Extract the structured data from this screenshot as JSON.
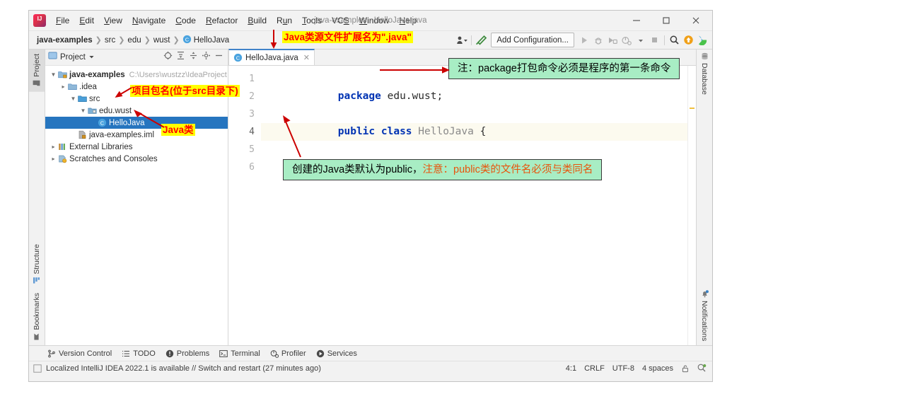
{
  "window": {
    "title": "java-examples - HelloJava.java",
    "logo_icon": "intellij-idea-logo",
    "minimize_label": "—",
    "maximize_label": "□",
    "close_label": "✕"
  },
  "menu": [
    {
      "label": "File",
      "mnemonic": "F"
    },
    {
      "label": "Edit",
      "mnemonic": "E"
    },
    {
      "label": "View",
      "mnemonic": "V"
    },
    {
      "label": "Navigate",
      "mnemonic": "N"
    },
    {
      "label": "Code",
      "mnemonic": "C"
    },
    {
      "label": "Refactor",
      "mnemonic": "R"
    },
    {
      "label": "Build",
      "mnemonic": "B"
    },
    {
      "label": "Run",
      "mnemonic": "u"
    },
    {
      "label": "Tools",
      "mnemonic": "T"
    },
    {
      "label": "VCS",
      "mnemonic": "S"
    },
    {
      "label": "Window",
      "mnemonic": "W"
    },
    {
      "label": "Help",
      "mnemonic": "H"
    }
  ],
  "breadcrumbs": [
    {
      "label": "java-examples",
      "icon": "",
      "bold": true
    },
    {
      "label": "src",
      "icon": "",
      "bold": false
    },
    {
      "label": "edu",
      "icon": "",
      "bold": false
    },
    {
      "label": "wust",
      "icon": "",
      "bold": false
    },
    {
      "label": "HelloJava",
      "icon": "java-class-icon",
      "bold": false
    }
  ],
  "toolbar": {
    "add_configuration_label": "Add Configuration...",
    "icons": [
      "user-dropdown-icon",
      "hammer-build-icon",
      "run-icon",
      "debug-icon",
      "run-with-coverage-icon",
      "profile-icon",
      "dropdown-icon",
      "stop-icon",
      "search-everywhere-icon",
      "update-icon",
      "ide-features-trainer-icon"
    ]
  },
  "project_panel": {
    "title": "Project",
    "dropdown_icon": "chevron-down-icon",
    "header_icons": [
      "locate-icon",
      "expand-all-icon",
      "collapse-all-icon",
      "settings-gear-icon",
      "hide-icon"
    ],
    "tree": [
      {
        "label": "java-examples",
        "detail": "C:\\Users\\wustzz\\IdeaProject",
        "icon": "module-icon",
        "arrow": "v",
        "indent": 0,
        "bold": true,
        "selected": false
      },
      {
        "label": ".idea",
        "detail": "",
        "icon": "folder-icon",
        "arrow": ">",
        "indent": 1,
        "bold": false,
        "selected": false
      },
      {
        "label": "src",
        "detail": "",
        "icon": "source-folder-icon",
        "arrow": "v",
        "indent": 1,
        "bold": false,
        "selected": false
      },
      {
        "label": "edu.wust",
        "detail": "",
        "icon": "package-icon",
        "arrow": "v",
        "indent": 2,
        "bold": false,
        "selected": false
      },
      {
        "label": "HelloJava",
        "detail": "",
        "icon": "java-class-icon",
        "arrow": "",
        "indent": 3,
        "bold": false,
        "selected": true
      },
      {
        "label": "java-examples.iml",
        "detail": "",
        "icon": "iml-file-icon",
        "arrow": "",
        "indent": 2,
        "bold": false,
        "selected": false
      },
      {
        "label": "External Libraries",
        "detail": "",
        "icon": "libraries-icon",
        "arrow": ">",
        "indent": 0,
        "bold": false,
        "selected": false
      },
      {
        "label": "Scratches and Consoles",
        "detail": "",
        "icon": "scratches-icon",
        "arrow": ">",
        "indent": 0,
        "bold": false,
        "selected": false
      }
    ]
  },
  "left_stripe": [
    {
      "label": "Project",
      "icon": "project-icon",
      "selected": true
    },
    {
      "label": "Structure",
      "icon": "structure-icon",
      "selected": false
    },
    {
      "label": "Bookmarks",
      "icon": "bookmarks-icon",
      "selected": false
    }
  ],
  "right_stripe": [
    {
      "label": "Database",
      "icon": "database-icon",
      "selected": false
    },
    {
      "label": "Notifications",
      "icon": "notifications-icon",
      "selected": false
    }
  ],
  "editor": {
    "tab": {
      "label": "HelloJava.java",
      "icon": "java-class-icon",
      "close_icon": "close-icon"
    },
    "line_numbers": [
      "1",
      "2",
      "3",
      "4",
      "5",
      "6"
    ],
    "current_line": "4",
    "lines": [
      {
        "n": "1",
        "tokens": [
          {
            "t": "package",
            "c": "kw"
          },
          {
            "t": " edu.wust;",
            "c": "plain"
          }
        ]
      },
      {
        "n": "2",
        "tokens": [
          {
            "t": "",
            "c": "plain"
          }
        ]
      },
      {
        "n": "3",
        "tokens": [
          {
            "t": "public",
            "c": "kw"
          },
          {
            "t": " ",
            "c": "plain"
          },
          {
            "t": "class",
            "c": "kw"
          },
          {
            "t": " ",
            "c": "plain"
          },
          {
            "t": "HelloJava",
            "c": "cls"
          },
          {
            "t": " {",
            "c": "plain"
          }
        ]
      },
      {
        "n": "4",
        "tokens": [
          {
            "t": "",
            "c": "plain"
          }
        ]
      },
      {
        "n": "5",
        "tokens": [
          {
            "t": "}",
            "c": "plain"
          }
        ]
      },
      {
        "n": "6",
        "tokens": [
          {
            "t": "",
            "c": "plain"
          }
        ]
      }
    ]
  },
  "bottom_tools": [
    {
      "label": "Version Control",
      "icon": "version-control-icon"
    },
    {
      "label": "TODO",
      "icon": "todo-icon"
    },
    {
      "label": "Problems",
      "icon": "problems-icon"
    },
    {
      "label": "Terminal",
      "icon": "terminal-icon"
    },
    {
      "label": "Profiler",
      "icon": "profiler-icon"
    },
    {
      "label": "Services",
      "icon": "services-icon"
    }
  ],
  "status_bar": {
    "message": "Localized IntelliJ IDEA 2022.1 is available // Switch and restart (27 minutes ago)",
    "message_icon": "notification-square-icon",
    "caret_position": "4:1",
    "line_separator": "CRLF",
    "encoding": "UTF-8",
    "indent": "4 spaces",
    "lock_icon": "read-only-lock-icon",
    "inspection_icon": "inspections-widget-icon"
  },
  "annotations": {
    "yellow_tab": "Java类源文件扩展名为\".java\"",
    "yellow_package": "项目包名(位于src目录下)",
    "yellow_class": "Java类",
    "green_package": "注：package打包命令必须是程序的第一条命令",
    "green_public_black": "创建的Java类默认为public，",
    "green_public_orange": "注意：public类的文件名必须与类同名",
    "arrow_color": "#cc0000",
    "highlight_color": "#ffff00",
    "box_color": "#a8edc4"
  }
}
